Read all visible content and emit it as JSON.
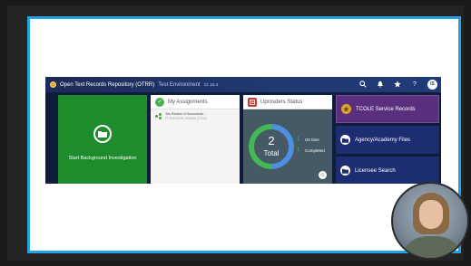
{
  "app": {
    "title": "Open Text Records Repository (OTRR)",
    "environment": "Test Environment",
    "version": "Cl: 24.4",
    "user_initials": "IS"
  },
  "toolbar": {
    "icons": [
      "search-icon",
      "bell-icon",
      "star-icon",
      "help-icon"
    ]
  },
  "tiles": {
    "background": {
      "label": "Start Background Investigation",
      "icon": "folder-icon"
    },
    "assignments": {
      "title": "My Assignments",
      "item_text": "Yes Review of Documents ...",
      "item_sub": "TT OLEASON, DENNIS (T1312)"
    },
    "status": {
      "title": "Uprosders Status",
      "total_value": "2",
      "total_label": "Total",
      "ontime_count": "1",
      "ontime_label": "On time",
      "completed_count": "1",
      "completed_label": "Completed",
      "ontime_fraction": 0.5,
      "completed_fraction": 0.5
    },
    "right": [
      {
        "label": "TCOLE Service Records",
        "icon": "badge-icon"
      },
      {
        "label": "Agency/Academy Files",
        "icon": "folder-icon"
      },
      {
        "label": "Licensee Search",
        "icon": "folder-icon"
      }
    ]
  },
  "colors": {
    "accent_blue": "#27a0e8",
    "tile_green": "#1e8b2d",
    "tile_purple": "#5a2f7e",
    "tile_navy": "#1c2d72",
    "ontime_color": "#4e8fe0",
    "completed_color": "#42b955"
  }
}
